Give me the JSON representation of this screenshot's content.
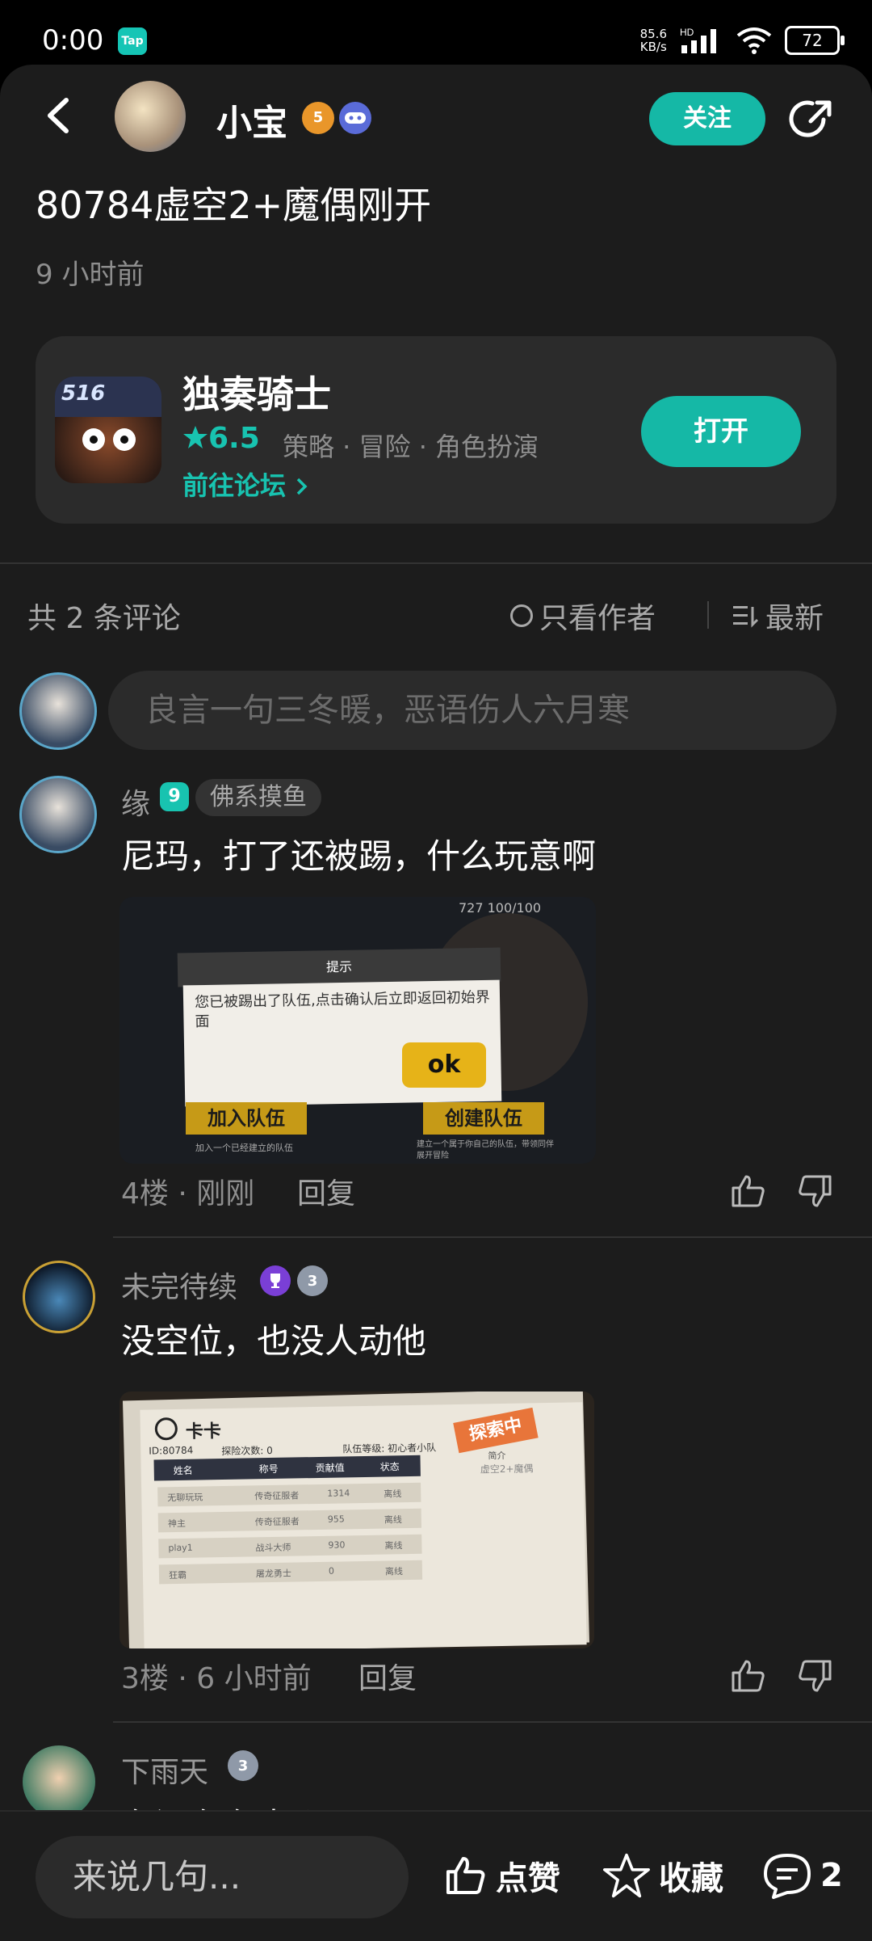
{
  "status_bar": {
    "time": "0:00",
    "app_badge": "Tap",
    "net_speed": "85.6",
    "net_unit": "KB/s",
    "net_label": "HD",
    "battery": "72"
  },
  "header": {
    "author": "小宝",
    "badge_level": "5",
    "follow_label": "关注"
  },
  "post": {
    "title": "80784虚空2+魔偶刚开",
    "time": "9 小时前"
  },
  "game": {
    "icon_label": "516",
    "name": "独奏骑士",
    "rating": "6.5",
    "tags": "策略 · 冒险 · 角色扮演",
    "forum_link": "前往论坛",
    "open_label": "打开"
  },
  "comments_bar": {
    "count_text": "共 2 条评论",
    "only_author": "只看作者",
    "sort": "最新"
  },
  "comment_input": {
    "placeholder": "良言一句三冬暖，恶语伤人六月寒"
  },
  "comments": [
    {
      "name": "缘",
      "level": "9",
      "tag": "佛系摸鱼",
      "text": "尼玛，打了还被踢，什么玩意啊",
      "meta": "4楼 · 刚刚",
      "reply": "回复",
      "image": {
        "dialog_title": "提示",
        "dialog_text": "您已被踢出了队伍,点击确认后立即返回初始界面",
        "ok": "ok",
        "join_btn": "加入队伍",
        "join_sub": "加入一个已经建立的队伍",
        "create_btn": "创建队伍",
        "create_sub": "建立一个属于你自己的队伍，带领同伴展开冒险",
        "top_stats": "727    100/100"
      }
    },
    {
      "name": "未完待续",
      "badge_level": "3",
      "text": "没空位，也没人动他",
      "meta": "3楼 · 6 小时前",
      "reply": "回复",
      "image": {
        "card_title": "卡卡",
        "stamp": "探索中",
        "id_label": "ID:80784",
        "explore_count": "探险次数: 0",
        "team_level": "队伍等级: 初心者小队",
        "intro_label": "简介",
        "intro_text": "虚空2+魔偶",
        "headers": [
          "姓名",
          "称号",
          "贡献值",
          "状态"
        ],
        "rows": [
          [
            "无聊玩玩",
            "传奇征服者",
            "1314",
            "离线"
          ],
          [
            "神主",
            "传奇征服者",
            "955",
            "离线"
          ],
          [
            "play1",
            "战斗大师",
            "930",
            "离线"
          ],
          [
            "狂霸",
            "屠龙勇士",
            "0",
            "离线"
          ]
        ]
      }
    },
    {
      "name": "下雨天",
      "badge_level": "3",
      "text": "有没有有米啊"
    }
  ],
  "bottom_bar": {
    "input_placeholder": "来说几句...",
    "like_label": "点赞",
    "collect_label": "收藏",
    "comment_count": "2"
  }
}
